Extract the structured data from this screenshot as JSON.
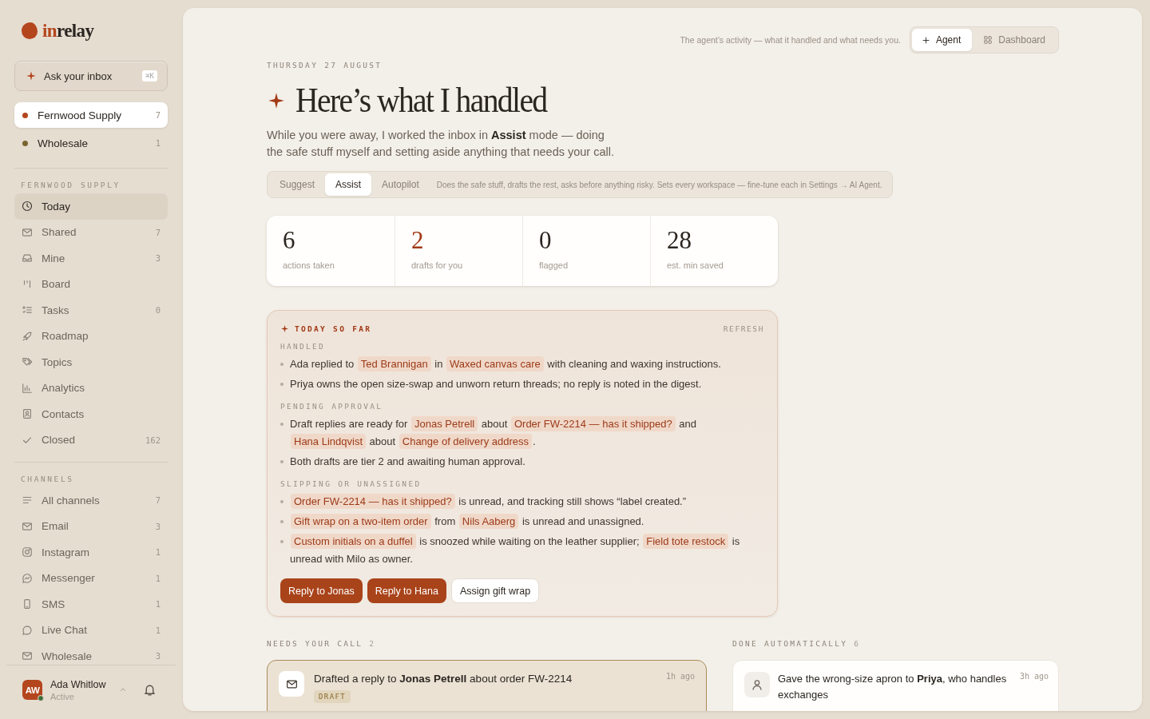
{
  "brand": {
    "accent": "in",
    "rest": "relay"
  },
  "ask": {
    "label": "Ask your inbox",
    "shortcut": "⌘K"
  },
  "workspaces": [
    {
      "name": "Fernwood Supply",
      "count": "7",
      "color": "#b4461e",
      "selected": true
    },
    {
      "name": "Wholesale",
      "count": "1",
      "color": "#7a6430",
      "selected": false
    }
  ],
  "nav_sections": [
    {
      "title": "FERNWOOD SUPPLY",
      "items": [
        {
          "label": "Today",
          "selected": true
        },
        {
          "label": "Shared",
          "count": "7",
          "selected": false
        },
        {
          "label": "Mine",
          "count": "3",
          "selected": false
        },
        {
          "label": "Board",
          "selected": false
        },
        {
          "label": "Tasks",
          "count": "0",
          "selected": false
        },
        {
          "label": "Roadmap",
          "selected": false
        },
        {
          "label": "Topics",
          "selected": false
        },
        {
          "label": "Analytics",
          "selected": false
        },
        {
          "label": "Contacts",
          "selected": false
        },
        {
          "label": "Closed",
          "count": "162",
          "selected": false
        }
      ]
    },
    {
      "title": "CHANNELS",
      "items": [
        {
          "label": "All channels",
          "count": "7",
          "selected": false
        },
        {
          "label": "Email",
          "count": "3",
          "selected": false
        },
        {
          "label": "Instagram",
          "count": "1",
          "selected": false
        },
        {
          "label": "Messenger",
          "count": "1",
          "selected": false
        },
        {
          "label": "SMS",
          "count": "1",
          "selected": false
        },
        {
          "label": "Live Chat",
          "count": "1",
          "selected": false
        },
        {
          "label": "Wholesale",
          "count": "3",
          "selected": false
        }
      ]
    }
  ],
  "user": {
    "name": "Ada Whitlow",
    "initials": "AW",
    "status": "Active",
    "online": true
  },
  "header": {
    "caption": "The agent’s activity — what it handled and what needs you.",
    "views": [
      {
        "label": "Agent",
        "selected": true
      },
      {
        "label": "Dashboard",
        "selected": false
      }
    ]
  },
  "date": "THURSDAY 27 AUGUST",
  "title": "Here’s what I handled",
  "intro": "While you were away, I worked the inbox in **Assist** mode — doing the safe stuff myself and setting aside anything that needs your call.",
  "modes": [
    {
      "label": "Suggest",
      "selected": false
    },
    {
      "label": "Assist",
      "selected": true
    },
    {
      "label": "Autopilot",
      "selected": false
    }
  ],
  "mode_hint": "Does the safe stuff, drafts the rest, asks before anything risky. Sets every workspace — fine-tune each in Settings → AI Agent.",
  "stats": [
    {
      "value": "6",
      "label": "actions taken",
      "accent": false
    },
    {
      "value": "2",
      "label": "drafts for you",
      "accent": true
    },
    {
      "value": "0",
      "label": "flagged",
      "accent": false
    },
    {
      "value": "28",
      "label": "est. min saved",
      "accent": false
    }
  ],
  "digest": {
    "title": "TODAY SO FAR",
    "action": "REFRESH",
    "groups": [
      {
        "heading": "HANDLED",
        "items": [
          [
            {
              "kind": "text",
              "text": "Ada replied to "
            },
            {
              "kind": "chip",
              "text": "Ted Brannigan"
            },
            {
              "kind": "text",
              "text": " in "
            },
            {
              "kind": "chip",
              "text": "Waxed canvas care"
            },
            {
              "kind": "text",
              "text": " with cleaning and waxing instructions."
            }
          ],
          [
            {
              "kind": "text",
              "text": "Priya owns the open size-swap and unworn return threads; no reply is noted in the digest."
            }
          ]
        ]
      },
      {
        "heading": "PENDING APPROVAL",
        "items": [
          [
            {
              "kind": "text",
              "text": "Draft replies are ready for "
            },
            {
              "kind": "chip",
              "text": "Jonas Petrell"
            },
            {
              "kind": "text",
              "text": " about "
            },
            {
              "kind": "chip",
              "text": "Order FW-2214 — has it shipped?"
            },
            {
              "kind": "text",
              "text": " and "
            },
            {
              "kind": "chip",
              "text": "Hana Lindqvist"
            },
            {
              "kind": "text",
              "text": " about "
            },
            {
              "kind": "chip",
              "text": "Change of delivery address"
            },
            {
              "kind": "text",
              "text": "."
            }
          ],
          [
            {
              "kind": "text",
              "text": "Both drafts are tier 2 and awaiting human approval."
            }
          ]
        ]
      },
      {
        "heading": "SLIPPING OR UNASSIGNED",
        "items": [
          [
            {
              "kind": "chip",
              "text": "Order FW-2214 — has it shipped?"
            },
            {
              "kind": "text",
              "text": " is unread, and tracking still shows “label created.”"
            }
          ],
          [
            {
              "kind": "chip",
              "text": "Gift wrap on a two-item order"
            },
            {
              "kind": "text",
              "text": " from "
            },
            {
              "kind": "chip",
              "text": "Nils Aaberg"
            },
            {
              "kind": "text",
              "text": " is unread and unassigned."
            }
          ],
          [
            {
              "kind": "chip",
              "text": "Custom initials on a duffel"
            },
            {
              "kind": "text",
              "text": " is snoozed while waiting on the leather supplier; "
            },
            {
              "kind": "chip",
              "text": "Field tote restock"
            },
            {
              "kind": "text",
              "text": " is unread with Milo as owner."
            }
          ]
        ]
      }
    ],
    "buttons": [
      {
        "label": "Reply to Jonas",
        "kind": "primary"
      },
      {
        "label": "Reply to Hana",
        "kind": "primary"
      },
      {
        "label": "Assign gift wrap",
        "kind": "secondary"
      }
    ]
  },
  "needs_call": {
    "title": "NEEDS YOUR CALL",
    "count": "2",
    "items": [
      {
        "text": "Drafted a reply to **Jonas Petrell** about order FW-2214",
        "time": "1h ago",
        "tag": "DRAFT"
      }
    ]
  },
  "done_auto": {
    "title": "DONE AUTOMATICALLY",
    "count": "6",
    "items": [
      {
        "text": "Gave the wrong-size apron to **Priya**, who handles exchanges",
        "time": "3h ago"
      }
    ]
  }
}
